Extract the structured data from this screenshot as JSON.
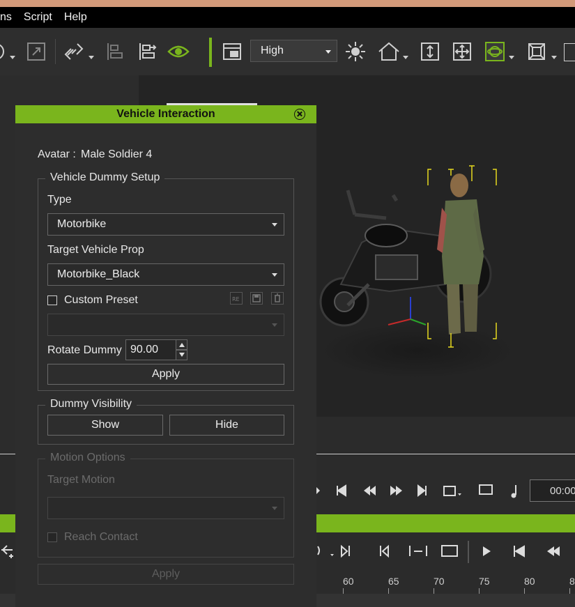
{
  "menubar": {
    "items": [
      "ns",
      "Script",
      "Help"
    ]
  },
  "toolbar": {
    "quality_value": "High",
    "icons": [
      "rotate-icon",
      "expand-icon",
      "link-icon",
      "align-left-icon",
      "align-distribute-icon",
      "visibility-eye-icon",
      "layout-icon",
      "light-icon",
      "home-icon",
      "fit-vertical-icon",
      "move-icon",
      "gizmo-icon",
      "bounding-box-icon"
    ],
    "accent_color": "#7ab51d"
  },
  "dialog": {
    "title": "Vehicle Interaction",
    "avatar_label": "Avatar :",
    "avatar_value": "Male Soldier 4",
    "dummy_setup": {
      "title": "Vehicle Dummy Setup",
      "type_label": "Type",
      "type_value": "Motorbike",
      "target_label": "Target Vehicle Prop",
      "target_value": "Motorbike_Black",
      "custom_preset_label": "Custom Preset",
      "custom_preset_checked": false,
      "preset_icons": [
        "rename-icon",
        "save-icon",
        "delete-icon"
      ],
      "rotate_label": "Rotate Dummy",
      "rotate_value": "90.00",
      "apply_label": "Apply"
    },
    "visibility": {
      "title": "Dummy Visibility",
      "show_label": "Show",
      "hide_label": "Hide"
    },
    "motion": {
      "title": "Motion Options",
      "target_motion_label": "Target Motion",
      "reach_contact_label": "Reach Contact",
      "enabled": false
    },
    "apply_label": "Apply"
  },
  "timeline": {
    "timecode": "00:00",
    "ruler_ticks": [
      "60",
      "65",
      "70",
      "75",
      "80",
      "8"
    ]
  }
}
